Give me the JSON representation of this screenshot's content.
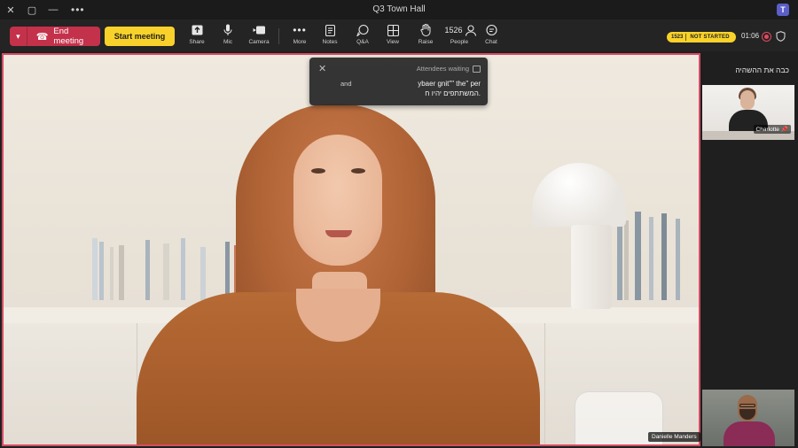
{
  "window": {
    "title": "Q3 Town Hall",
    "more_glyph": "•••",
    "logo_letter": "T"
  },
  "toolbar": {
    "end_meeting_label": "End meeting",
    "start_meeting_label": "Start meeting",
    "items": [
      {
        "label": "Share",
        "icon": "share-icon"
      },
      {
        "label": "Mic",
        "icon": "mic-icon"
      },
      {
        "label": "Camera",
        "icon": "camera-icon"
      },
      {
        "label": "More",
        "icon": "more-icon"
      },
      {
        "label": "Notes",
        "icon": "notes-icon"
      },
      {
        "label": "Q&A",
        "icon": "qa-icon"
      },
      {
        "label": "View",
        "icon": "view-icon"
      },
      {
        "label": "Raise",
        "icon": "raise-hand-icon"
      },
      {
        "label": "People",
        "icon": "people-icon",
        "count": "1526"
      },
      {
        "label": "Chat",
        "icon": "chat-icon"
      }
    ],
    "status": {
      "attendee_count": "1523",
      "state": "NOT STARTED"
    },
    "timer": "01:06"
  },
  "notification": {
    "title": "Attendees waiting",
    "line1": "ybaer gnit\"\" the\" per",
    "line1b": "and",
    "line2": "המשתתפים יהיו ח."
  },
  "right_panel": {
    "title": "כבה את ההשהיה",
    "thumb1_name": "Charlotte",
    "thumb2_name": "Danielle Manders"
  },
  "main_video": {
    "name": "Danielle Manders"
  },
  "colors": {
    "end_red": "#c4314b",
    "start_yellow": "#f8d22a",
    "active_border": "#d54b63",
    "background": "#1f1f1f"
  }
}
